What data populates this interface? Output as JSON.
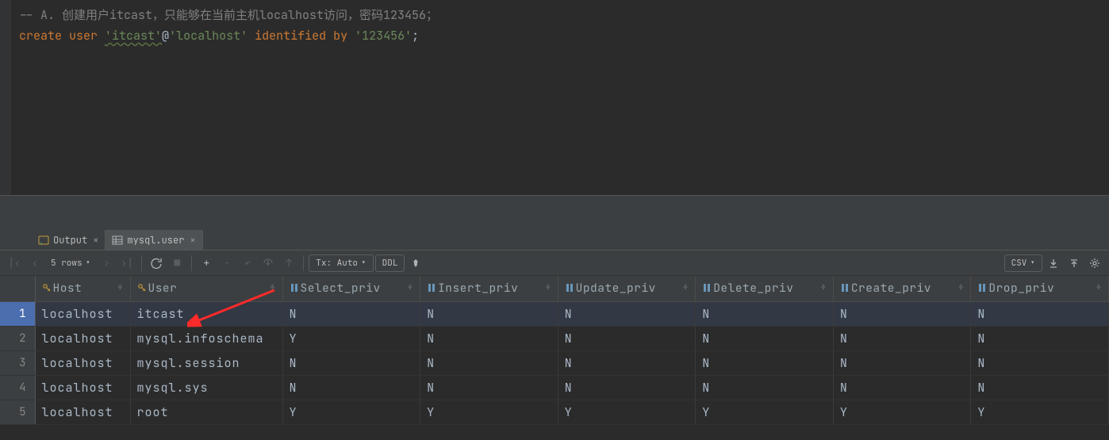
{
  "editor": {
    "comment": "-- A. 创建用户itcast，只能够在当前主机localhost访问，密码123456；",
    "sql_parts": {
      "kw1": "create user",
      "str1": "'itcast'",
      "at": "@",
      "str2": "'localhost'",
      "kw2": "identified by",
      "str3": "'123456'",
      "semi": ";"
    }
  },
  "tabs": {
    "output": "Output",
    "table": "mysql.user"
  },
  "toolbar": {
    "rows": "5 rows",
    "tx": "Tx: Auto",
    "ddl": "DDL",
    "csv": "CSV"
  },
  "columns": [
    "Host",
    "User",
    "Select_priv",
    "Insert_priv",
    "Update_priv",
    "Delete_priv",
    "Create_priv",
    "Drop_priv"
  ],
  "rows": [
    {
      "n": "1",
      "host": "localhost",
      "user": "itcast",
      "sel": "N",
      "ins": "N",
      "upd": "N",
      "del": "N",
      "cre": "N",
      "drp": "N",
      "selected": true
    },
    {
      "n": "2",
      "host": "localhost",
      "user": "mysql.infoschema",
      "sel": "Y",
      "ins": "N",
      "upd": "N",
      "del": "N",
      "cre": "N",
      "drp": "N"
    },
    {
      "n": "3",
      "host": "localhost",
      "user": "mysql.session",
      "sel": "N",
      "ins": "N",
      "upd": "N",
      "del": "N",
      "cre": "N",
      "drp": "N"
    },
    {
      "n": "4",
      "host": "localhost",
      "user": "mysql.sys",
      "sel": "N",
      "ins": "N",
      "upd": "N",
      "del": "N",
      "cre": "N",
      "drp": "N"
    },
    {
      "n": "5",
      "host": "localhost",
      "user": "root",
      "sel": "Y",
      "ins": "Y",
      "upd": "Y",
      "del": "Y",
      "cre": "Y",
      "drp": "Y"
    }
  ]
}
